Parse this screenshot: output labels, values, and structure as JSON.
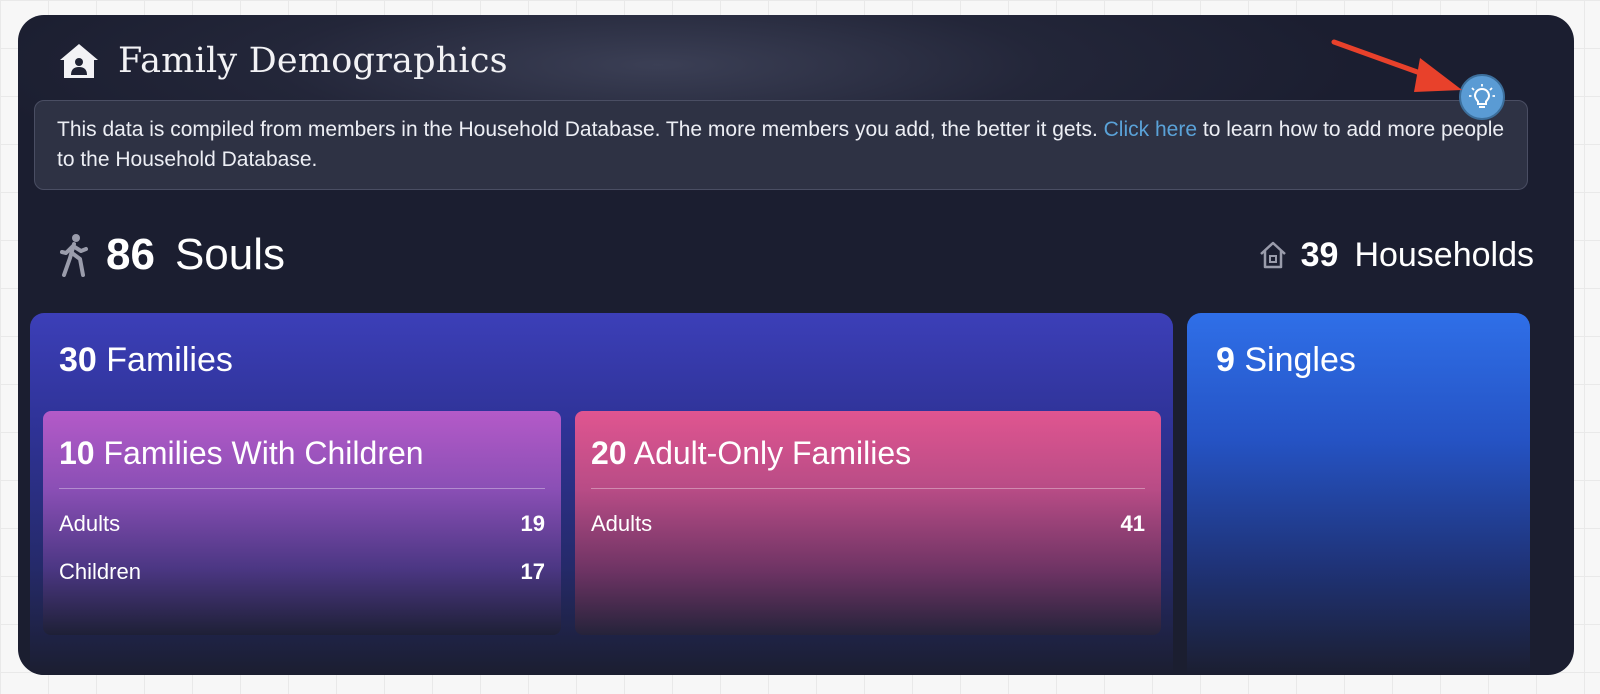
{
  "header": {
    "title": "Family Demographics",
    "icon": "home-icon"
  },
  "info": {
    "text": "This data is compiled from members in the Household Database. The more members you add, the better it gets.",
    "link_text": "Click here",
    "text_after": "to learn how to add more people to the Household Database."
  },
  "tip_button": {
    "icon": "lightbulb-icon"
  },
  "souls": {
    "count": "86",
    "label": "Souls",
    "icon": "walking-person-icon"
  },
  "households": {
    "count": "39",
    "label": "Households",
    "icon": "house-outline-icon"
  },
  "families": {
    "count": "30",
    "label": "Families",
    "with_children": {
      "count": "10",
      "label": "Families With Children",
      "rows": [
        {
          "label": "Adults",
          "value": "19"
        },
        {
          "label": "Children",
          "value": "17"
        }
      ]
    },
    "adult_only": {
      "count": "20",
      "label": "Adult-Only Families",
      "rows": [
        {
          "label": "Adults",
          "value": "41"
        }
      ]
    }
  },
  "singles": {
    "count": "9",
    "label": "Singles"
  },
  "colors": {
    "card_bg": "#1b1e30",
    "families_panel": "#3c3fb8",
    "children_card": "#b45ac8",
    "adult_card": "#e05590",
    "singles_panel": "#2f6fe8",
    "link": "#5aa2d8",
    "tip_button": "#5a9bd4",
    "annotation_arrow": "#e8412b"
  }
}
